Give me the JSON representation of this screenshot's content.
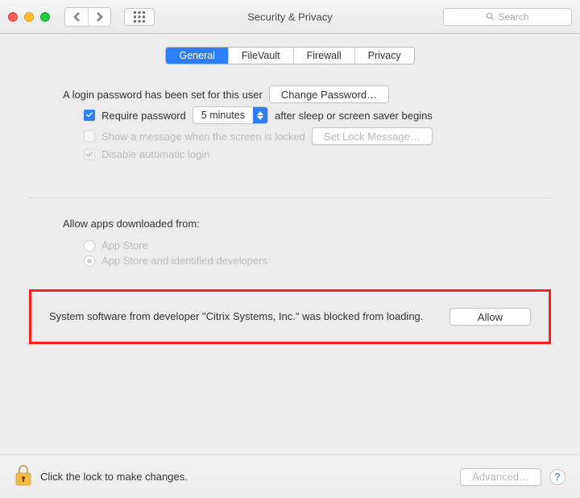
{
  "window": {
    "title": "Security & Privacy",
    "search_placeholder": "Search"
  },
  "tabs": {
    "general": "General",
    "filevault": "FileVault",
    "firewall": "Firewall",
    "privacy": "Privacy"
  },
  "login": {
    "intro": "A login password has been set for this user",
    "change_password": "Change Password…",
    "require_password": "Require password",
    "delay_value": "5 minutes",
    "after_text": "after sleep or screen saver begins",
    "show_message": "Show a message when the screen is locked",
    "set_lock_message": "Set Lock Message…",
    "disable_auto_login": "Disable automatic login"
  },
  "downloads": {
    "heading": "Allow apps downloaded from:",
    "opt_appstore": "App Store",
    "opt_appstore_identified": "App Store and identified developers"
  },
  "blocked": {
    "message": "System software from developer \"Citrix Systems, Inc.\" was blocked from loading.",
    "allow": "Allow"
  },
  "footer": {
    "lock_text": "Click the lock to make changes.",
    "advanced": "Advanced…",
    "help": "?"
  }
}
